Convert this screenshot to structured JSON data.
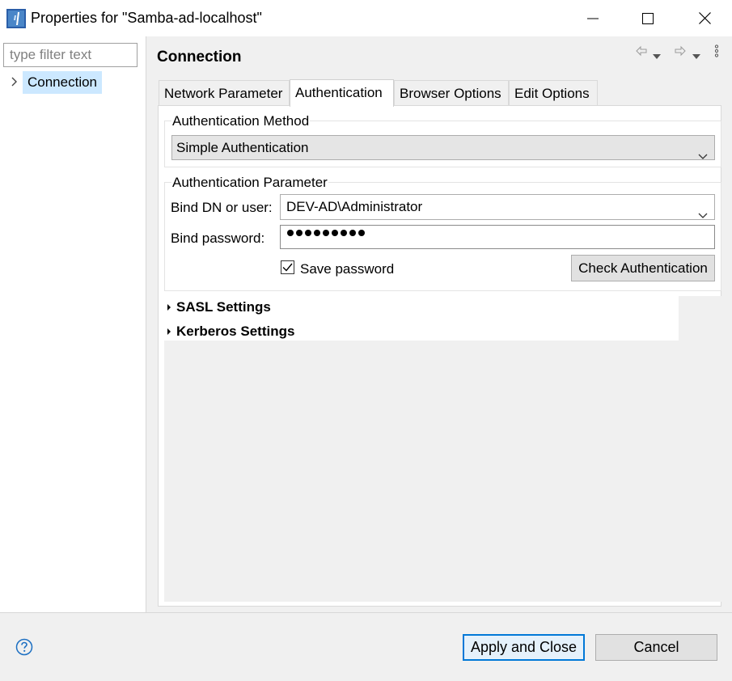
{
  "window": {
    "title": "Properties for \"Samba-ad-localhost\"",
    "icons": [
      "app-icon",
      "minimize-icon",
      "maximize-icon",
      "close-icon"
    ]
  },
  "sidebar": {
    "filter_placeholder": "type filter text",
    "items": [
      {
        "label": "Connection",
        "selected": true,
        "expandable": true
      }
    ]
  },
  "page": {
    "title": "Connection",
    "nav_icons": [
      "back-arrow-icon",
      "dropdown-icon",
      "forward-arrow-icon",
      "dropdown-icon",
      "view-menu-icon"
    ]
  },
  "tabs": [
    {
      "label": "Network Parameter",
      "active": false
    },
    {
      "label": "Authentication",
      "active": true
    },
    {
      "label": "Browser Options",
      "active": false
    },
    {
      "label": "Edit Options",
      "active": false
    }
  ],
  "auth_method": {
    "group_label": "Authentication Method",
    "selected": "Simple Authentication"
  },
  "auth_param": {
    "group_label": "Authentication Parameter",
    "bind_dn_label": "Bind DN or user:",
    "bind_dn_value": "DEV-AD\\Administrator",
    "bind_password_label": "Bind password:",
    "password_mask_length": 9,
    "save_password_label": "Save password",
    "save_password_checked": true,
    "check_button": "Check Authentication"
  },
  "sections": [
    {
      "label": "SASL Settings",
      "expanded": false
    },
    {
      "label": "Kerberos Settings",
      "expanded": false
    }
  ],
  "footer": {
    "apply_button": "Apply and Close",
    "cancel_button": "Cancel",
    "help_icon": "help-icon"
  },
  "colors": {
    "selection": "#cce8ff",
    "accent": "#0078d7",
    "panel": "#f0f0f0"
  }
}
